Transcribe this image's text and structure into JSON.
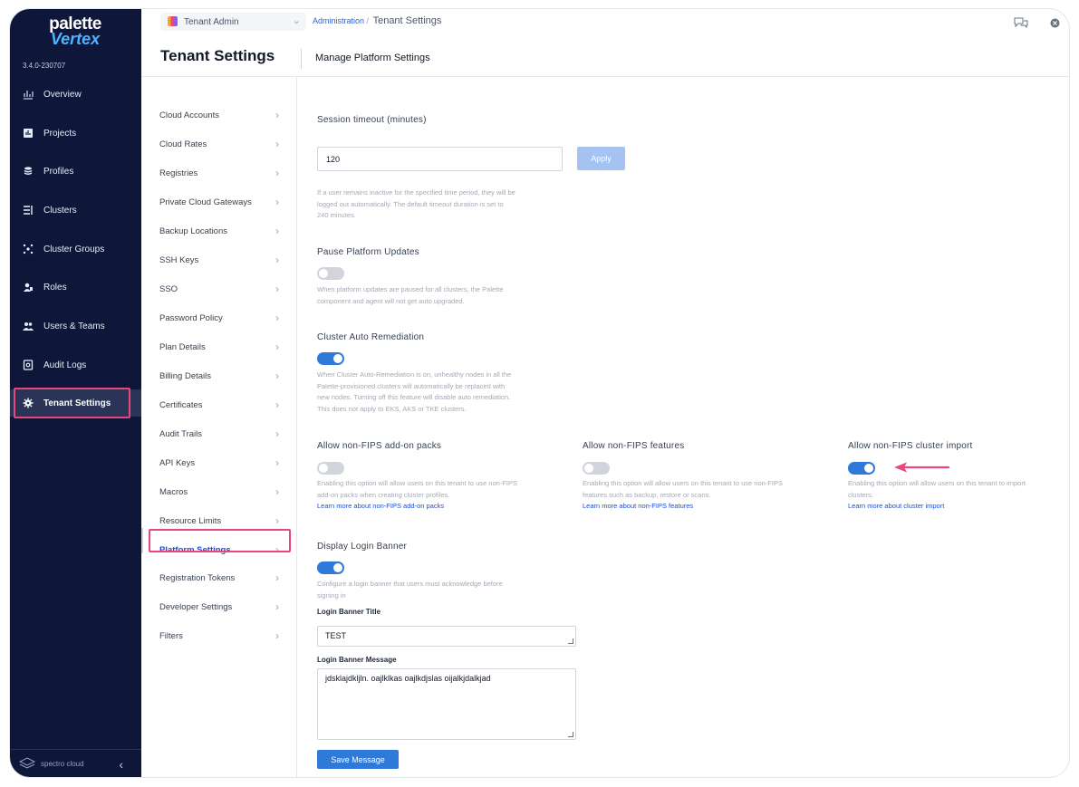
{
  "brand": {
    "line1": "palette",
    "line2": "Vertex",
    "version": "3.4.0-230707",
    "footer": "spectro cloud"
  },
  "colors": {
    "sidebar_bg": "#0e1739",
    "accent": "#2f7ad8",
    "highlight": "#e8467c"
  },
  "sidebar": {
    "items": [
      {
        "label": "Overview",
        "icon": "chart-icon"
      },
      {
        "label": "Projects",
        "icon": "projects-icon"
      },
      {
        "label": "Profiles",
        "icon": "stack-icon"
      },
      {
        "label": "Clusters",
        "icon": "clusters-icon"
      },
      {
        "label": "Cluster Groups",
        "icon": "cluster-groups-icon"
      },
      {
        "label": "Roles",
        "icon": "roles-icon"
      },
      {
        "label": "Users & Teams",
        "icon": "users-icon"
      },
      {
        "label": "Audit Logs",
        "icon": "audit-icon"
      },
      {
        "label": "Tenant Settings",
        "icon": "gear-icon"
      }
    ]
  },
  "topbar": {
    "scope": "Tenant Admin",
    "breadcrumb_link": "Administration",
    "breadcrumb_sep": "/",
    "breadcrumb_current": "Tenant Settings"
  },
  "header": {
    "title": "Tenant Settings",
    "subtitle": "Manage Platform Settings"
  },
  "menu": {
    "items": [
      "Cloud Accounts",
      "Cloud Rates",
      "Registries",
      "Private Cloud Gateways",
      "Backup Locations",
      "SSH Keys",
      "SSO",
      "Password Policy",
      "Plan Details",
      "Billing Details",
      "Certificates",
      "Audit Trails",
      "API Keys",
      "Macros",
      "Resource Limits",
      "Platform Settings",
      "Registration Tokens",
      "Developer Settings",
      "Filters"
    ]
  },
  "settings": {
    "session": {
      "label": "Session timeout (minutes)",
      "value": "120",
      "apply": "Apply",
      "help_1": "If a user remains inactive for the specified time period, they will be",
      "help_2": "logged out automatically. The default timeout duration is set to",
      "help_3": "240 minutes."
    },
    "pause": {
      "label": "Pause Platform Updates",
      "enabled": false,
      "help_1": "When platform updates are paused for all clusters, the Palette",
      "help_2": "component and agent will not get auto upgraded."
    },
    "remediation": {
      "label": "Cluster Auto Remediation",
      "enabled": true,
      "help_1": "When Cluster Auto-Remediation is on, unhealthy nodes in all the",
      "help_2": "Palette-provisioned clusters will automatically be replaced with",
      "help_3": "new nodes. Turning off this feature will disable auto remediation.",
      "help_4": "This does not apply to EKS, AKS or TKE clusters."
    },
    "fips_packs": {
      "label": "Allow non-FIPS add-on packs",
      "enabled": false,
      "help_1": "Enabling this option will allow users on this tenant to use non-FIPS",
      "help_2": "add-on packs when creating cluster profiles.",
      "link": "Learn more about non-FIPS add-on packs"
    },
    "fips_features": {
      "label": "Allow non-FIPS features",
      "enabled": false,
      "help_1": "Enabling this option will allow users on this tenant to use non-FIPS",
      "help_2": "features such as backup, restore or scans.",
      "link": "Learn more about non-FIPS features"
    },
    "fips_import": {
      "label": "Allow non-FIPS cluster import",
      "enabled": true,
      "help_1": "Enabling this option will allow users on this tenant to import",
      "help_2": "clusters.",
      "link": "Learn more about cluster import"
    },
    "banner": {
      "label": "Display Login Banner",
      "enabled": true,
      "help_1": "Configure a login banner that users must acknowledge before",
      "help_2": "signing in",
      "title_label": "Login Banner Title",
      "title_value": "TEST",
      "message_label": "Login Banner Message",
      "message_value": "jdsklajdkljln. oajlklkas oajlkdjslas oijalkjdalkjad",
      "save": "Save Message"
    }
  }
}
